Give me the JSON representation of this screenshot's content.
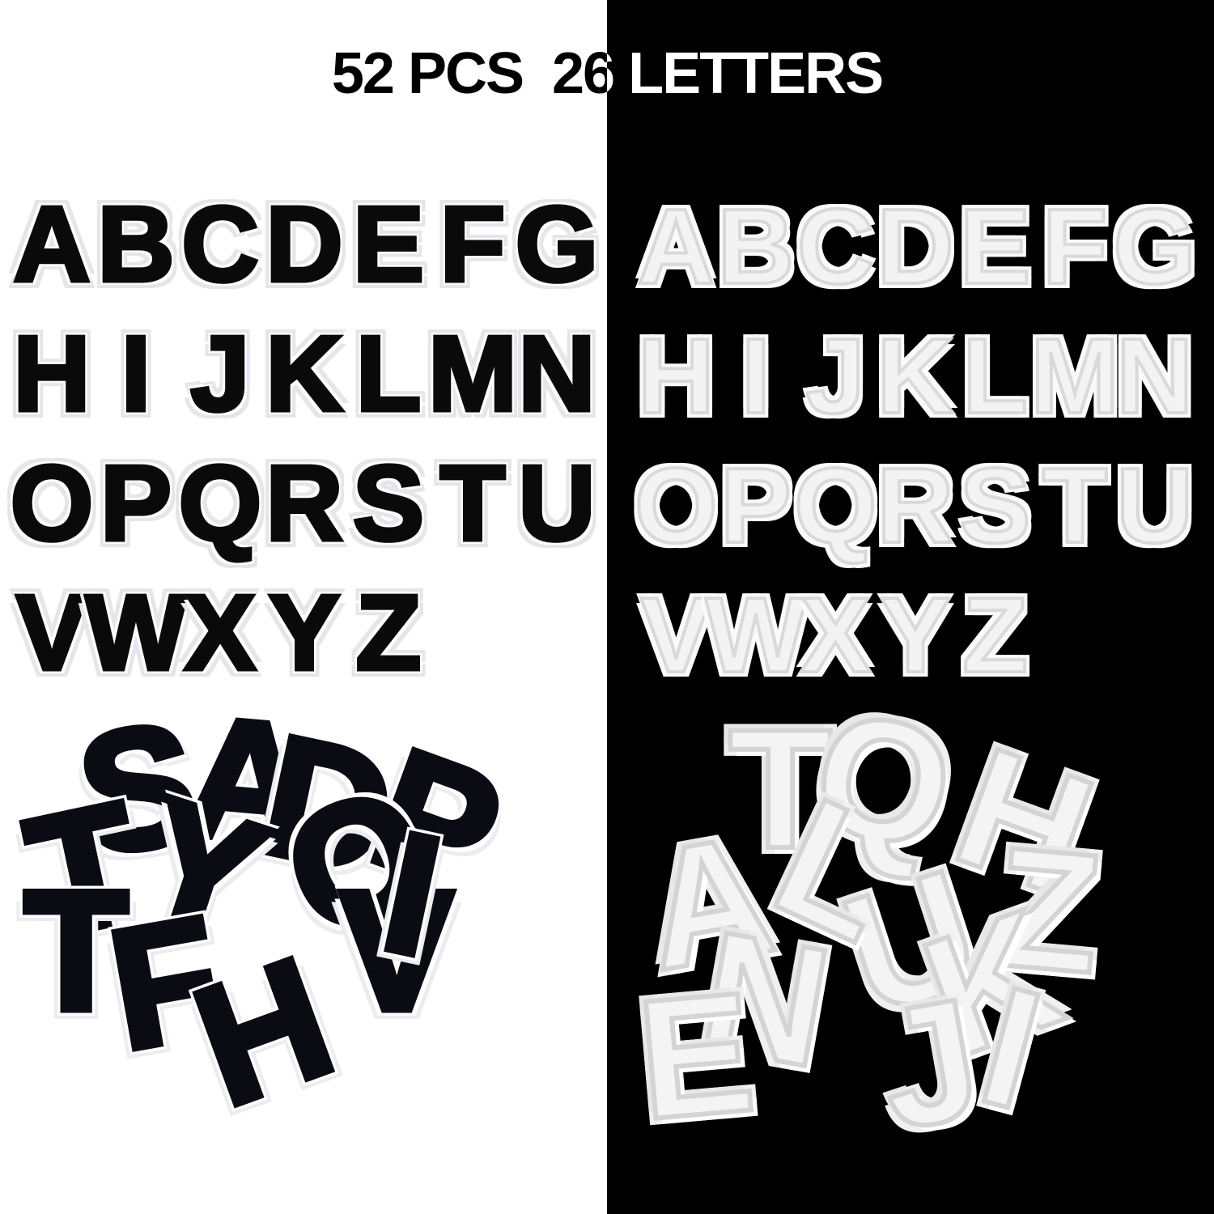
{
  "title": "52 PCS  26 LETTERS",
  "letters": [
    "A",
    "B",
    "C",
    "D",
    "E",
    "F",
    "G",
    "H",
    "I",
    "J",
    "K",
    "L",
    "M",
    "N",
    "O",
    "P",
    "Q",
    "R",
    "S",
    "T",
    "U",
    "V",
    "W",
    "X",
    "Y",
    "Z"
  ],
  "colors": {
    "left_background": "#ffffff",
    "right_background": "#000000",
    "black_patch": "#0a0a0a",
    "white_patch": "#f3f3f3"
  },
  "pile_black": [
    "S",
    "A",
    "D",
    "T",
    "Y",
    "P",
    "T",
    "Q",
    "F",
    "V",
    "I",
    "H"
  ],
  "pile_white": [
    "T",
    "Q",
    "A",
    "H",
    "Z",
    "U",
    "N",
    "K",
    "E",
    "I",
    "L",
    "J"
  ]
}
